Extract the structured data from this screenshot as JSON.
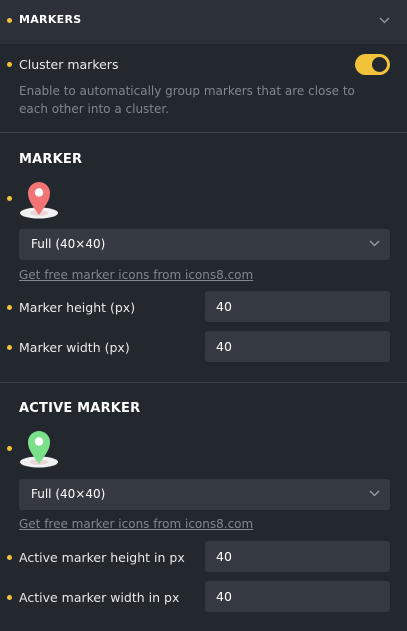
{
  "header": {
    "title": "MARKERS"
  },
  "cluster": {
    "label": "Cluster markers",
    "enabled": true,
    "description": "Enable to automatically group markers that are close to each other into a cluster."
  },
  "marker": {
    "title": "MARKER",
    "icon_color": "#f27474",
    "select_value": "Full (40×40)",
    "link": "Get free marker icons from icons8.com",
    "height_label": "Marker height (px)",
    "height_value": "40",
    "width_label": "Marker width (px)",
    "width_value": "40"
  },
  "active_marker": {
    "title": "ACTIVE MARKER",
    "icon_color": "#7be08a",
    "select_value": "Full (40×40)",
    "link": "Get free marker icons from icons8.com",
    "height_label": "Active marker height in px",
    "height_value": "40",
    "width_label": "Active marker width in px",
    "width_value": "40"
  },
  "colors": {
    "accent": "#f2c33a",
    "background": "#23272e",
    "field": "#343942"
  }
}
